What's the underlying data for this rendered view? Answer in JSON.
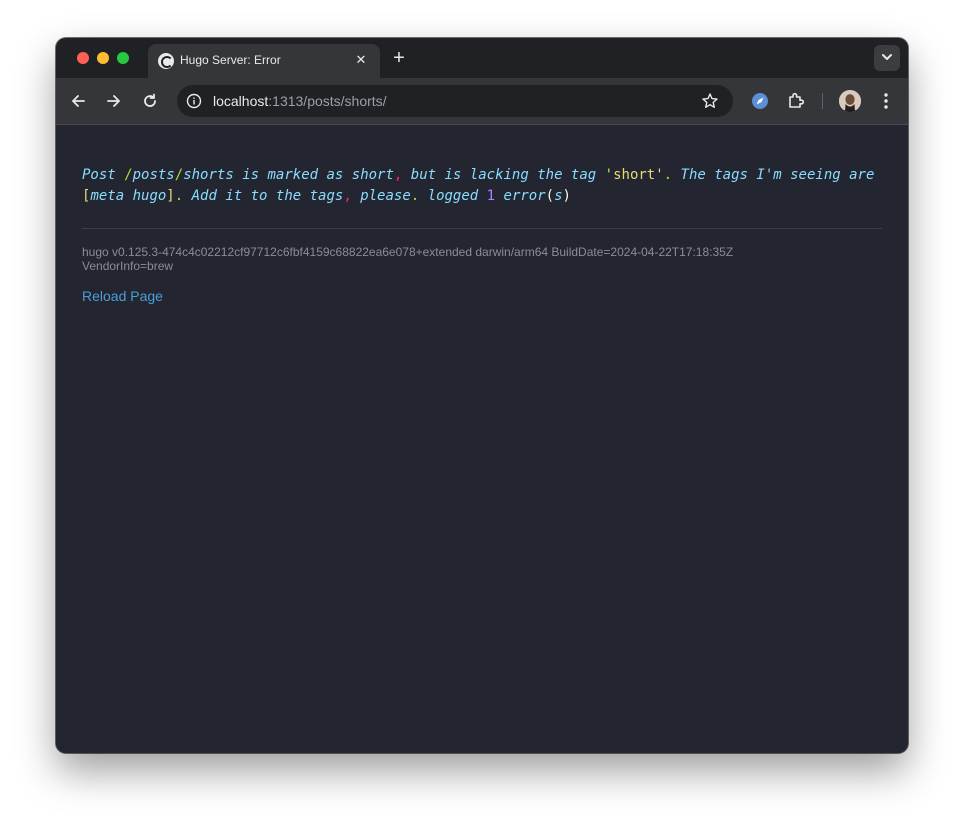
{
  "browser": {
    "tab": {
      "title": "Hugo Server: Error",
      "close_glyph": "✕",
      "favicon": "hugo-favicon-icon"
    },
    "new_tab_glyph": "+",
    "url": {
      "host": "localhost",
      "path": ":1313/posts/shorts/"
    }
  },
  "error": {
    "part1": "Post ",
    "path_slash1": "/",
    "path_seg1": "posts",
    "path_slash2": "/",
    "path_seg2": "shorts",
    "part2": " is marked as short",
    "comma1": ",",
    "part3": " but is lacking the tag ",
    "quoted_tag": "'short'",
    "dot1": ".",
    "part4": " The tags I'm seeing are ",
    "bracket_open": "[",
    "tags": "meta hugo",
    "bracket_close": "]",
    "dot2": ".",
    "part5": " Add it to the tags",
    "comma2": ",",
    "part6": " please",
    "dot3": ".",
    "part7": "  logged ",
    "count": "1",
    "part8": " error",
    "paren_open": "(",
    "paren_s": "s",
    "paren_close": ")"
  },
  "version_line1": "hugo v0.125.3-474c4c02212cf97712c6fbf4159c68822ea6e078+extended darwin/arm64 BuildDate=2024-04-22T17:18:35Z",
  "version_line2": "VendorInfo=brew",
  "reload_label": "Reload Page",
  "colors": {
    "page_bg": "#232530",
    "error_text": "#88ddff",
    "link": "#4a9fd8"
  }
}
